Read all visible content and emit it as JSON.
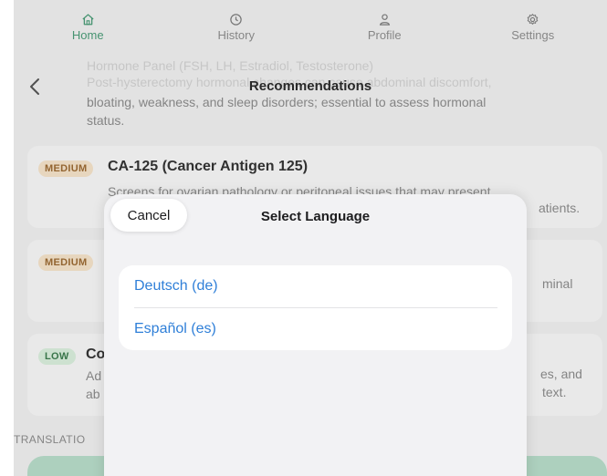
{
  "tabs": [
    {
      "label": "Home",
      "icon": "home-icon",
      "active": true
    },
    {
      "label": "History",
      "icon": "clock-icon",
      "active": false
    },
    {
      "label": "Profile",
      "icon": "person-icon",
      "active": false
    },
    {
      "label": "Settings",
      "icon": "gear-icon",
      "active": false
    }
  ],
  "header": {
    "back_icon": "chevron-left-icon",
    "title": "Recommendations"
  },
  "top_card": {
    "faded_line_1": "Hormone Panel (FSH, LH, Estradiol, Testosterone)",
    "faded_line_2": "Post-hysterectomy hormonal changes can cause abdominal discomfort,",
    "desc_line_1": "bloating, weakness, and sleep disorders; essential to assess hormonal",
    "desc_line_2": "status."
  },
  "cards": [
    {
      "priority": "MEDIUM",
      "title": "CA-125 (Cancer Antigen 125)",
      "desc_line_1": "Screens for ovarian pathology or peritoneal issues that may present",
      "right_fragment": "atients."
    },
    {
      "priority": "MEDIUM",
      "right_fragment": "minal"
    },
    {
      "priority": "LOW",
      "title_fragment": "Co",
      "left_fragment_1": "Ad",
      "left_fragment_2": "ab",
      "right_fragment_1": "es, and",
      "right_fragment_2": "text."
    }
  ],
  "section_label": "TRANSLATIO",
  "modal": {
    "cancel_label": "Cancel",
    "title": "Select Language",
    "languages": [
      {
        "label": "Deutsch (de)"
      },
      {
        "label": "Español (es)"
      }
    ]
  },
  "colors": {
    "accent_green": "#4a9a76",
    "link_blue": "#2f7fd8",
    "medium_badge_bg": "#f1dfc6",
    "low_badge_bg": "#d6ebd9"
  }
}
